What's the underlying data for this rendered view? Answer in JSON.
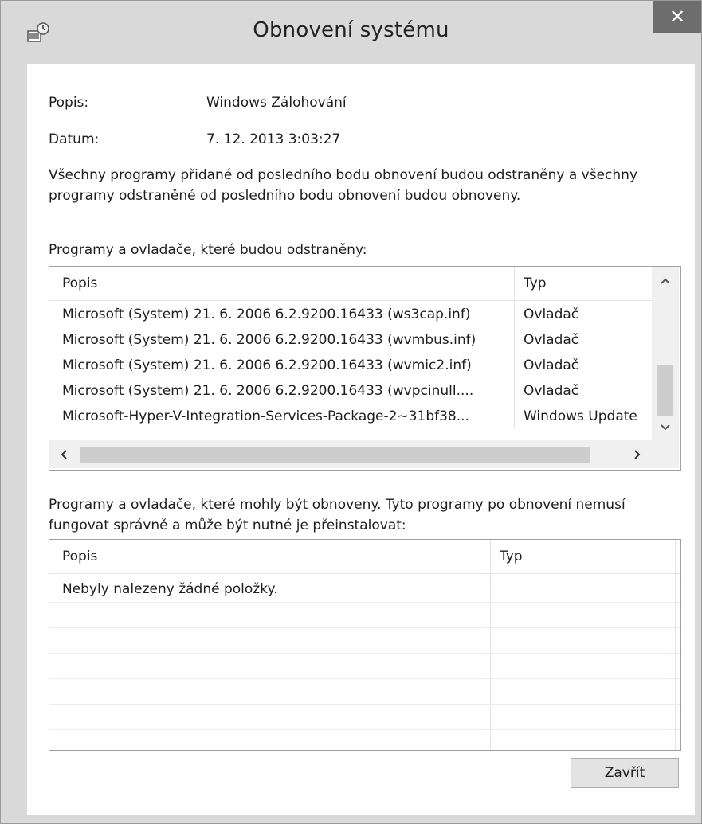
{
  "window": {
    "title": "Obnovení systému",
    "close_glyph": "✕",
    "icon": "system-restore-icon"
  },
  "details": {
    "popis_label": "Popis:",
    "popis_value": "Windows Zálohování",
    "datum_label": "Datum:",
    "datum_value": "7. 12. 2013 3:03:27",
    "description_line1": "Všechny programy přidané od posledního bodu obnovení budou odstraněny a všechny",
    "description_line2": "programy odstraněné od posledního bodu obnovení budou obnoveny."
  },
  "removed": {
    "heading": "Programy a ovladače, které budou odstraněny:",
    "columns": [
      "Popis",
      "Typ"
    ],
    "rows": [
      [
        "Microsoft (System) 21. 6. 2006 6.2.9200.16433 (ws3cap.inf)",
        "Ovladač"
      ],
      [
        "Microsoft (System) 21. 6. 2006 6.2.9200.16433 (wvmbus.inf)",
        "Ovladač"
      ],
      [
        "Microsoft (System) 21. 6. 2006 6.2.9200.16433 (wvmic2.inf)",
        "Ovladač"
      ],
      [
        "Microsoft (System) 21. 6. 2006 6.2.9200.16433 (wvpcinull....",
        "Ovladač"
      ],
      [
        "Microsoft-Hyper-V-Integration-Services-Package-2~31bf38...",
        "Windows Update"
      ]
    ]
  },
  "restored": {
    "heading_line1": "Programy a ovladače, které mohly být obnoveny. Tyto programy po obnovení nemusí",
    "heading_line2": "fungovat správně a může být nutné je přeinstalovat:",
    "columns": [
      "Popis",
      "Typ"
    ],
    "empty_text": "Nebyly nalezeny žádné položky."
  },
  "buttons": {
    "close_label": "Zavřít"
  }
}
